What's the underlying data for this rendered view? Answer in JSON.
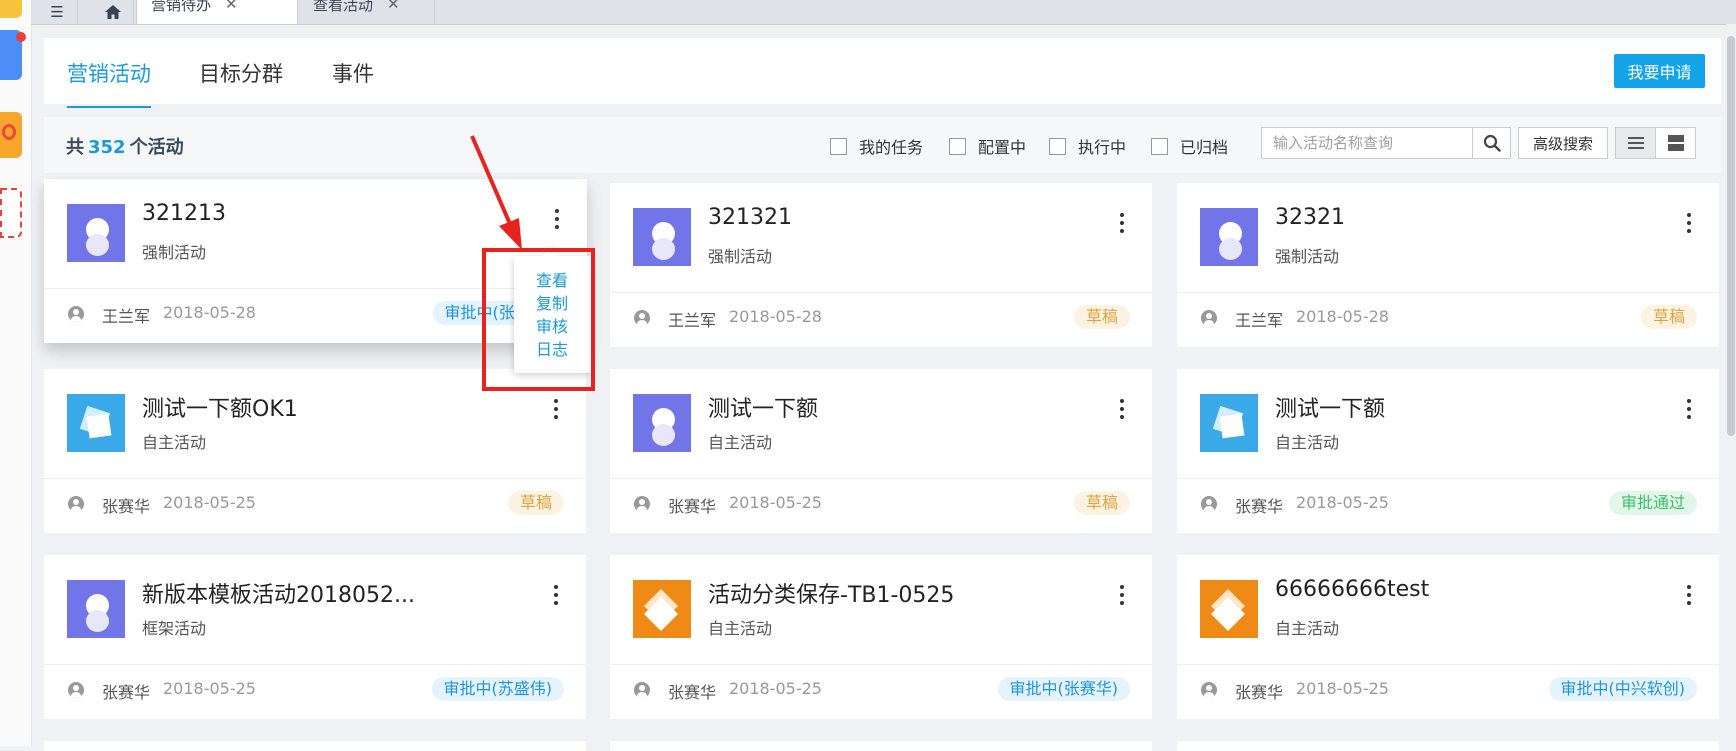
{
  "left_apps": [
    "app-icon",
    "app-icon",
    "app-icon",
    "app-icon"
  ],
  "tabbar": {
    "menu_icon": "menu-icon",
    "home_icon": "home-icon",
    "tabs": [
      {
        "label": "营销待办",
        "close": "✕"
      },
      {
        "label": "查看活动",
        "close": "✕"
      }
    ]
  },
  "header": {
    "nav": [
      "营销活动",
      "目标分群",
      "事件"
    ],
    "apply_button": "我要申请"
  },
  "summary": {
    "prefix": "共",
    "count": "352",
    "suffix": "个活动",
    "filters": [
      "我的任务",
      "配置中",
      "执行中",
      "已归档"
    ],
    "search_placeholder": "输入活动名称查询",
    "advanced_search": "高级搜索"
  },
  "cards": [
    {
      "title": "321213",
      "type": "强制活动",
      "user": "王兰军",
      "date": "2018-05-28",
      "status": "审批中(张赛华)",
      "status_kind": "reviewing",
      "thumb": "purple"
    },
    {
      "title": "321321",
      "type": "强制活动",
      "user": "王兰军",
      "date": "2018-05-28",
      "status": "草稿",
      "status_kind": "draft",
      "thumb": "purple"
    },
    {
      "title": "32321",
      "type": "强制活动",
      "user": "王兰军",
      "date": "2018-05-28",
      "status": "草稿",
      "status_kind": "draft",
      "thumb": "purple"
    },
    {
      "title": "测试一下额OK1",
      "type": "自主活动",
      "user": "张赛华",
      "date": "2018-05-25",
      "status": "草稿",
      "status_kind": "draft",
      "thumb": "blue"
    },
    {
      "title": "测试一下额",
      "type": "自主活动",
      "user": "张赛华",
      "date": "2018-05-25",
      "status": "草稿",
      "status_kind": "draft",
      "thumb": "purple"
    },
    {
      "title": "测试一下额",
      "type": "自主活动",
      "user": "张赛华",
      "date": "2018-05-25",
      "status": "审批通过",
      "status_kind": "approved",
      "thumb": "blue"
    },
    {
      "title": "新版本模板活动2018052...",
      "type": "框架活动",
      "user": "张赛华",
      "date": "2018-05-25",
      "status": "审批中(苏盛伟)",
      "status_kind": "reviewing",
      "thumb": "purple"
    },
    {
      "title": "活动分类保存-TB1-0525",
      "type": "自主活动",
      "user": "张赛华",
      "date": "2018-05-25",
      "status": "审批中(张赛华)",
      "status_kind": "reviewing",
      "thumb": "orange"
    },
    {
      "title": "66666666test",
      "type": "自主活动",
      "user": "张赛华",
      "date": "2018-05-25",
      "status": "审批中(中兴软创)",
      "status_kind": "reviewing",
      "thumb": "orange"
    }
  ],
  "popup_menu": [
    "查看",
    "复制",
    "审核",
    "日志"
  ],
  "colors": {
    "accent": "#1a9bd7",
    "apply_button": "#14a2e8",
    "annotation": "#e8231e",
    "draft": "#e0a33f",
    "approved": "#3bbf6a"
  }
}
